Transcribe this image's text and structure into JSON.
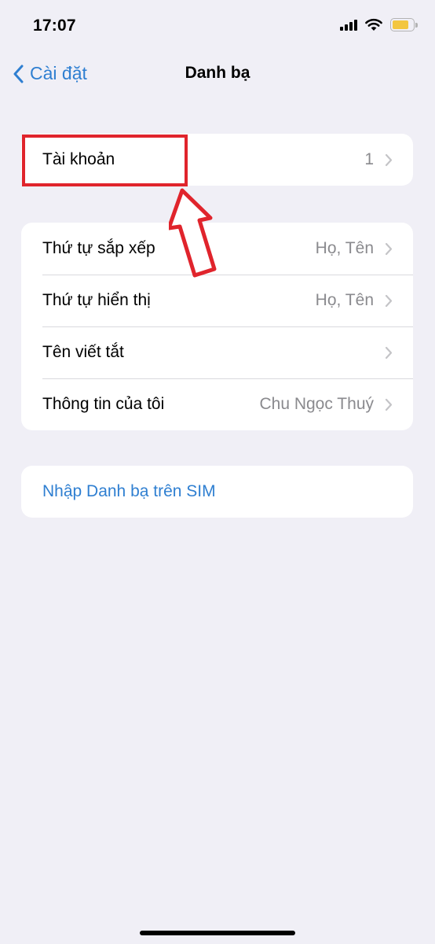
{
  "status_bar": {
    "time": "17:07",
    "signal_icon": "cellular-signal-icon",
    "wifi_icon": "wifi-icon",
    "battery_icon": "battery-icon",
    "battery_color": "#f3c63f"
  },
  "nav": {
    "back_label": "Cài đặt",
    "back_icon": "chevron-left-icon",
    "title": "Danh bạ"
  },
  "accounts_group": {
    "rows": [
      {
        "label": "Tài khoản",
        "value": "1"
      }
    ]
  },
  "settings_group": {
    "rows": [
      {
        "label": "Thứ tự sắp xếp",
        "value": "Họ, Tên"
      },
      {
        "label": "Thứ tự hiển thị",
        "value": "Họ, Tên"
      },
      {
        "label": "Tên viết tắt",
        "value": ""
      },
      {
        "label": "Thông tin của tôi",
        "value": "Chu Ngọc Thuý"
      }
    ]
  },
  "import_group": {
    "link_label": "Nhập Danh bạ trên SIM"
  },
  "colors": {
    "accent": "#2f7fd1",
    "background": "#f0eff6",
    "highlight": "#e0242c"
  }
}
